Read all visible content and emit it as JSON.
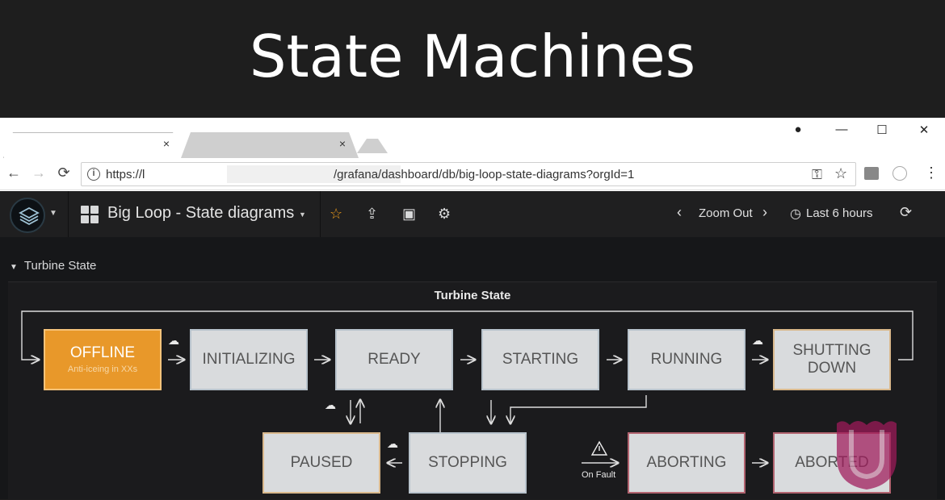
{
  "slide": {
    "title": "State Machines"
  },
  "browser": {
    "tabs": [
      {
        "close": "×"
      },
      {
        "close": "×"
      }
    ],
    "window_controls": {
      "account": "●",
      "minimize": "—",
      "maximize": "☐",
      "close": "✕"
    },
    "nav": {
      "back": "←",
      "forward": "→",
      "reload": "⟳"
    },
    "url_start": "https://l",
    "url_end": "/grafana/dashboard/db/big-loop-state-diagrams?orgId=1",
    "toolbar": {
      "key": "⚿",
      "star": "☆",
      "menu": "⋮"
    }
  },
  "grafana": {
    "dashboard_title": "Big Loop - State diagrams",
    "zoom_out": "Zoom Out",
    "time_range": "Last 6 hours",
    "row_title": "Turbine State",
    "panel_title": "Turbine State",
    "on_fault_label": "On Fault",
    "states": {
      "offline": {
        "label": "OFFLINE",
        "sub": "Anti-iceing in XXs"
      },
      "initializing": {
        "label": "INITIALIZING"
      },
      "ready": {
        "label": "READY"
      },
      "starting": {
        "label": "STARTING"
      },
      "running": {
        "label": "RUNNING"
      },
      "shutting_down": {
        "label": "SHUTTING DOWN"
      },
      "paused": {
        "label": "PAUSED"
      },
      "stopping": {
        "label": "STOPPING"
      },
      "aborting": {
        "label": "ABORTING"
      },
      "aborted": {
        "label": "ABORTED"
      }
    },
    "colors": {
      "active": "#e8982a",
      "state_bg": "#d9dbdd",
      "star": "#eb9b1a"
    }
  }
}
